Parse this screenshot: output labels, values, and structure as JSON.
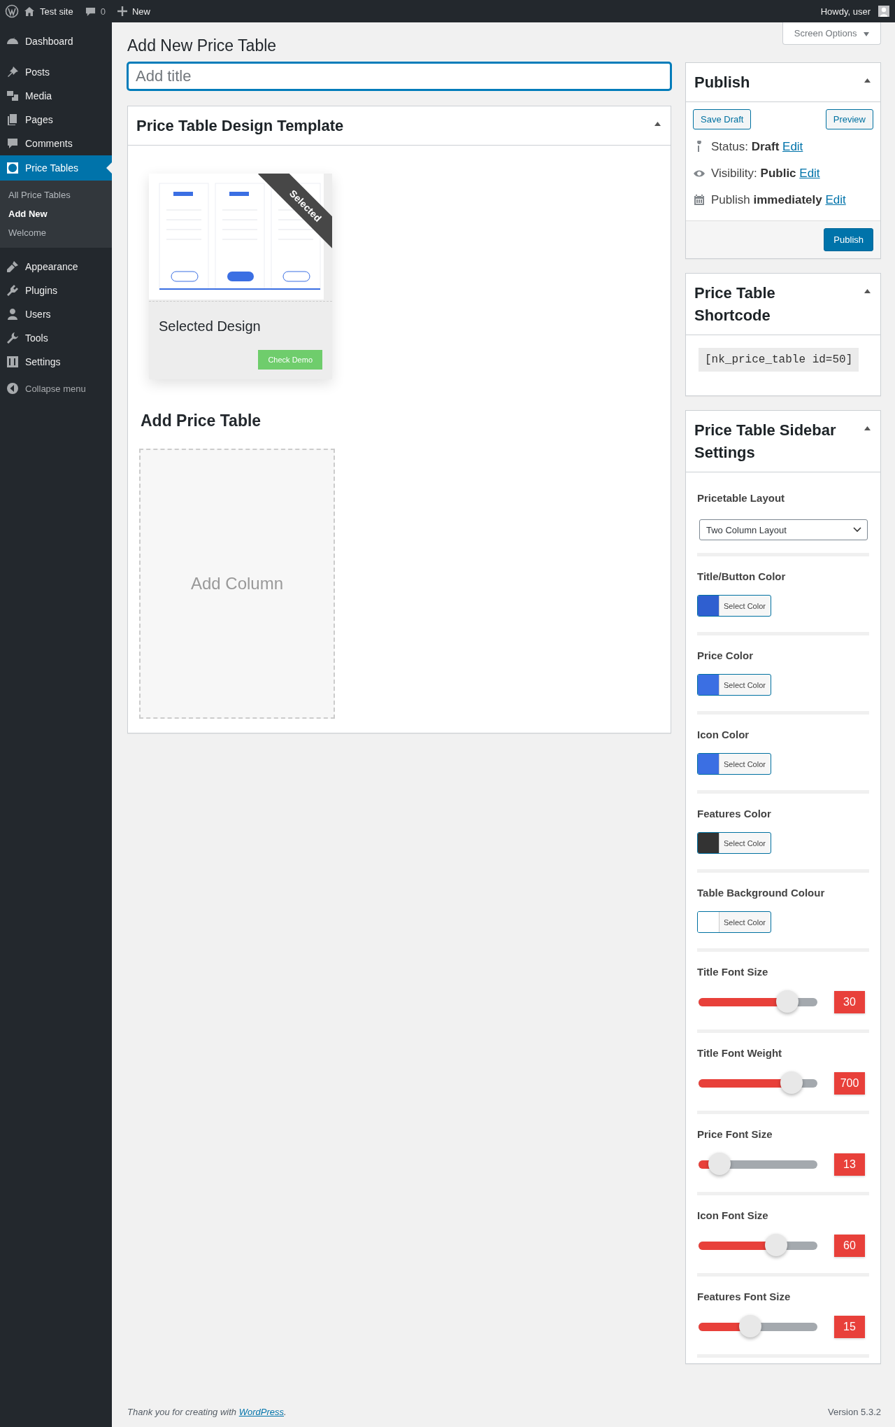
{
  "admin_bar": {
    "site": "Test site",
    "comments": "0",
    "new": "New",
    "greeting": "Howdy, user"
  },
  "menu": [
    {
      "label": "Dashboard",
      "selected": false
    },
    {
      "label": "Posts",
      "selected": false
    },
    {
      "label": "Media",
      "selected": false
    },
    {
      "label": "Pages",
      "selected": false
    },
    {
      "label": "Comments",
      "selected": false
    },
    {
      "label": "Price Tables",
      "selected": true,
      "children": [
        {
          "label": "All Price Tables",
          "selected": false
        },
        {
          "label": "Add New",
          "selected": true
        },
        {
          "label": "Welcome",
          "selected": false
        }
      ]
    },
    {
      "label": "Appearance",
      "selected": false
    },
    {
      "label": "Plugins",
      "selected": false
    },
    {
      "label": "Users",
      "selected": false
    },
    {
      "label": "Tools",
      "selected": false
    },
    {
      "label": "Settings",
      "selected": false
    }
  ],
  "collapse": "Collapse menu",
  "screen_options": "Screen Options",
  "page_title": "Add New Price Table",
  "title_field": {
    "placeholder": "Add title"
  },
  "design_box": {
    "title": "Price Table Design Template",
    "ribbon": "Selected",
    "card_title": "Selected Design",
    "demo_button": "Check Demo"
  },
  "add_table": {
    "heading": "Add Price Table",
    "add_column": "Add Column"
  },
  "publish": {
    "title": "Publish",
    "save_draft": "Save Draft",
    "preview": "Preview",
    "rows": [
      {
        "kind": "status",
        "text": "Status: **Draft**",
        "link": "Edit"
      },
      {
        "kind": "visibility",
        "text": "Visibility: **Public**",
        "link": "Edit"
      },
      {
        "kind": "schedule",
        "text": "Publish **immediately**",
        "link": "Edit"
      }
    ],
    "button": "Publish"
  },
  "shortcode": {
    "title": "Price Table Shortcode",
    "code": "[nk_price_table id=50]"
  },
  "settings": {
    "title": "Price Table Sidebar Settings",
    "fields": [
      {
        "kind": "select",
        "label": "Pricetable Layout",
        "value": "Two Column Layout"
      },
      {
        "kind": "color",
        "label": "Title/Button Color",
        "color": "#2f5fd0",
        "button": "Select Color"
      },
      {
        "kind": "color",
        "label": "Price Color",
        "color": "#3b6fe3",
        "button": "Select Color"
      },
      {
        "kind": "color",
        "label": "Icon Color",
        "color": "#3b6fe3",
        "button": "Select Color"
      },
      {
        "kind": "color",
        "label": "Features Color",
        "color": "#333333",
        "button": "Select Color"
      },
      {
        "kind": "color",
        "label": "Table Background Colour",
        "color": "#ffffff",
        "button": "Select Color"
      },
      {
        "kind": "slider",
        "label": "Title Font Size",
        "level": 0.75,
        "reading": "30"
      },
      {
        "kind": "slider",
        "label": "Title Font Weight",
        "level": 0.79,
        "reading": "700"
      },
      {
        "kind": "slider",
        "label": "Price Font Size",
        "level": 0.18,
        "reading": "13"
      },
      {
        "kind": "slider",
        "label": "Icon Font Size",
        "level": 0.66,
        "reading": "60"
      },
      {
        "kind": "slider",
        "label": "Features Font Size",
        "level": 0.44,
        "reading": "15"
      }
    ]
  },
  "footer": {
    "before": "Thank you for creating with ",
    "link": "WordPress",
    "after": ".",
    "version": "Version 5.3.2"
  }
}
